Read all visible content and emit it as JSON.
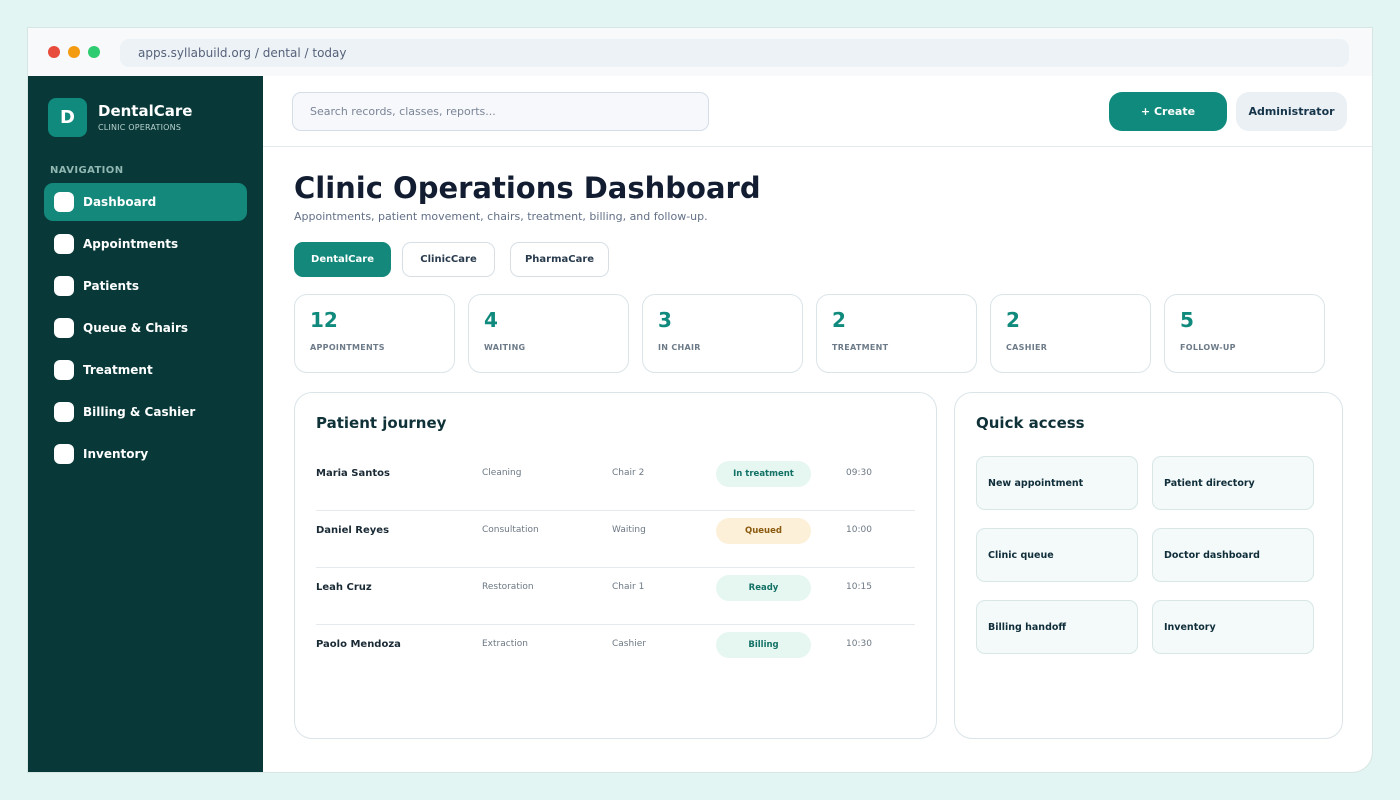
{
  "browser": {
    "url": "apps.syllabuild.org / dental / today"
  },
  "brand": {
    "logo_letter": "D",
    "name": "DentalCare",
    "subtitle": "CLINIC OPERATIONS"
  },
  "sidebar": {
    "heading": "NAVIGATION",
    "items": [
      {
        "label": "Dashboard",
        "active": true
      },
      {
        "label": "Appointments",
        "active": false
      },
      {
        "label": "Patients",
        "active": false
      },
      {
        "label": "Queue & Chairs",
        "active": false
      },
      {
        "label": "Treatment",
        "active": false
      },
      {
        "label": "Billing & Cashier",
        "active": false
      },
      {
        "label": "Inventory",
        "active": false
      }
    ]
  },
  "topbar": {
    "search_placeholder": "Search records, classes, reports...",
    "create_label": "+ Create",
    "user_label": "Administrator"
  },
  "page": {
    "title": "Clinic Operations Dashboard",
    "subtitle": "Appointments, patient movement, chairs, treatment, billing, and follow-up."
  },
  "chips": [
    {
      "label": "DentalCare",
      "active": true
    },
    {
      "label": "ClinicCare",
      "active": false
    },
    {
      "label": "PharmaCare",
      "active": false
    }
  ],
  "stats": [
    {
      "value": "12",
      "label": "APPOINTMENTS"
    },
    {
      "value": "4",
      "label": "WAITING"
    },
    {
      "value": "3",
      "label": "IN CHAIR"
    },
    {
      "value": "2",
      "label": "TREATMENT"
    },
    {
      "value": "2",
      "label": "CASHIER"
    },
    {
      "value": "5",
      "label": "FOLLOW-UP"
    }
  ],
  "journey": {
    "title": "Patient journey",
    "rows": [
      {
        "name": "Maria Santos",
        "procedure": "Cleaning",
        "location": "Chair 2",
        "status": "In treatment",
        "time": "09:30"
      },
      {
        "name": "Daniel Reyes",
        "procedure": "Consultation",
        "location": "Waiting",
        "status": "Queued",
        "time": "10:00"
      },
      {
        "name": "Leah Cruz",
        "procedure": "Restoration",
        "location": "Chair 1",
        "status": "Ready",
        "time": "10:15"
      },
      {
        "name": "Paolo Mendoza",
        "procedure": "Extraction",
        "location": "Cashier",
        "status": "Billing",
        "time": "10:30"
      }
    ]
  },
  "quick_access": {
    "title": "Quick access",
    "items": [
      "New appointment",
      "Patient directory",
      "Clinic queue",
      "Doctor dashboard",
      "Billing handoff",
      "Inventory"
    ]
  },
  "colors": {
    "accent": "#0f8a7c",
    "sidebar": "#083838",
    "status_teal_bg": "#e6f6f1",
    "status_amber_bg": "#fdf0d8"
  }
}
